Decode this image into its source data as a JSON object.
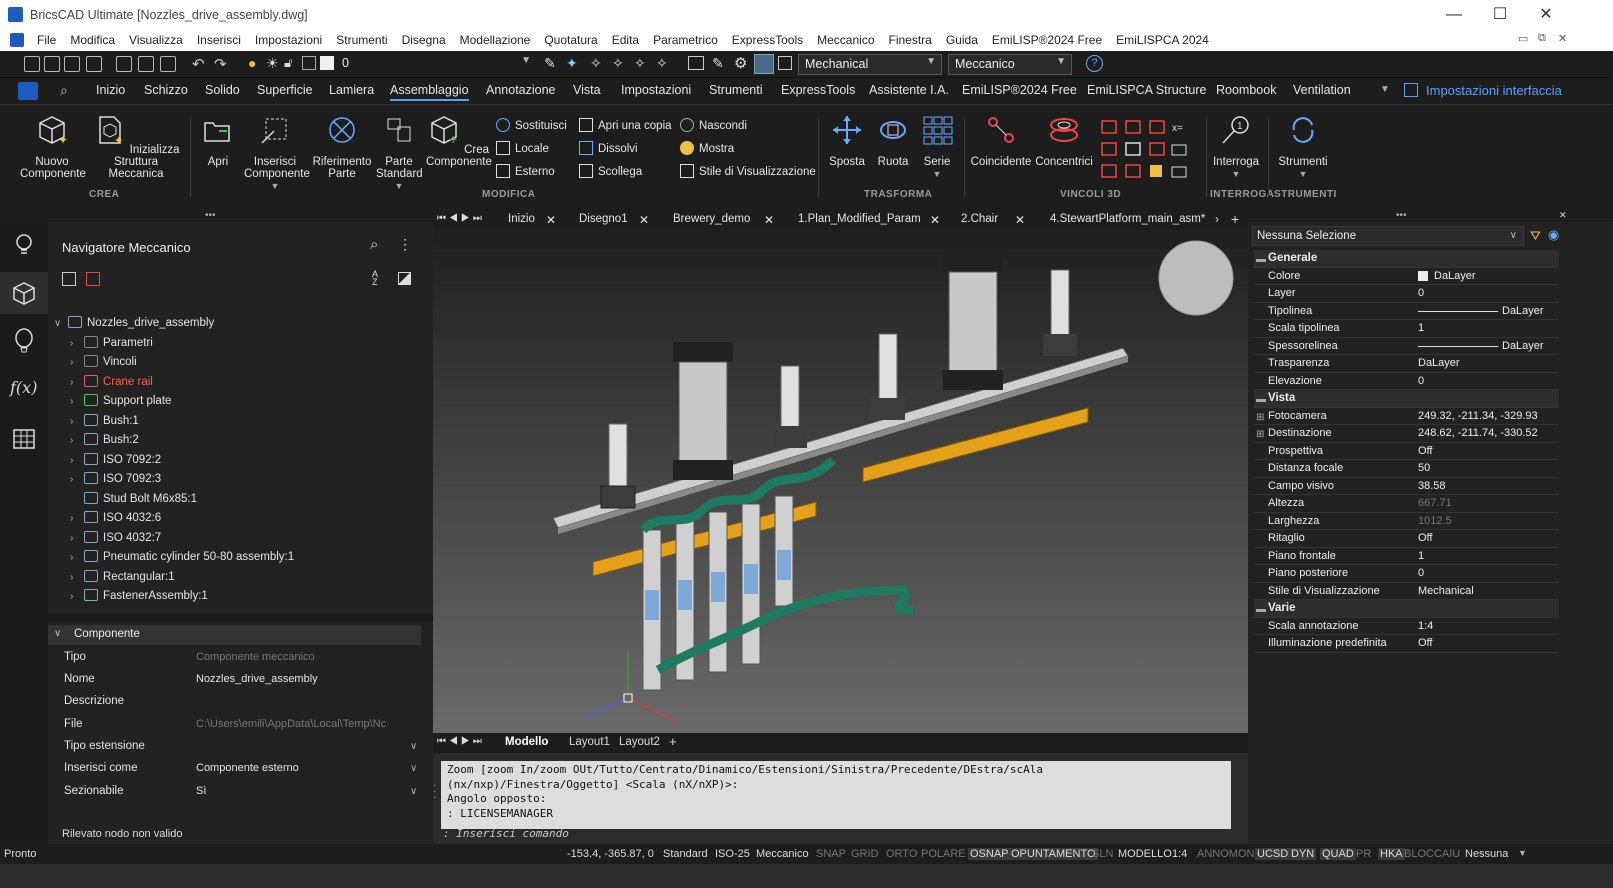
{
  "title_bar": {
    "app": "BricsCAD Ultimate",
    "file": "[Nozzles_drive_assembly.dwg]",
    "minimize": "—",
    "maximize": "☐",
    "close": "✕"
  },
  "menu": [
    "File",
    "Modifica",
    "Visualizza",
    "Inserisci",
    "Impostazioni",
    "Strumenti",
    "Disegna",
    "Modellazione",
    "Quotatura",
    "Edita",
    "Parametrico",
    "ExpressTools",
    "Meccanico",
    "Finestra",
    "Guida",
    "EmiLISP®2024 Free",
    "EmiLISPCA 2024"
  ],
  "qat": {
    "layer_value": "0",
    "workspace": "Mechanical",
    "profile": "Meccanico"
  },
  "ribbon_tabs": [
    "Inizio",
    "Schizzo",
    "Solido",
    "Superficie",
    "Lamiera",
    "Assemblaggio",
    "Annotazione",
    "Vista",
    "Impostazioni",
    "Strumenti",
    "ExpressTools",
    "Assistente I.A.",
    "EmiLISP®2024 Free",
    "EmiLISPCA Structure",
    "Roombook",
    "Ventilation"
  ],
  "ribbon_settings": "Impostazioni interfaccia",
  "ribbon": {
    "crea": {
      "label": "CREA",
      "nuovo": "Nuovo Componente",
      "inizializza": "Inizializza Struttura Meccanica"
    },
    "modifica": {
      "label": "MODIFICA",
      "apri": "Apri",
      "inserisci": "Inserisci Componente",
      "riferimento": "Riferimento Parte",
      "parte": "Parte Standard",
      "crea_comp": "Crea Componente",
      "sostituisci": "Sostituisci",
      "locale": "Locale",
      "esterno": "Esterno",
      "apri_copia": "Apri una copia",
      "dissolvi": "Dissolvi",
      "scollega": "Scollega",
      "nascondi": "Nascondi",
      "mostra": "Mostra",
      "stile": "Stile di Visualizzazione"
    },
    "trasforma": {
      "label": "TRASFORMA",
      "sposta": "Sposta",
      "ruota": "Ruota",
      "serie": "Serie"
    },
    "vincoli": {
      "label": "VINCOLI 3D",
      "coincidente": "Coincidente",
      "concentrici": "Concentrici"
    },
    "interroga": {
      "label": "INTERROGA",
      "interroga": "Interroga"
    },
    "strumenti": {
      "label": "STRUMENTI",
      "strumenti": "Strumenti"
    }
  },
  "navigator": {
    "title": "Navigatore Meccanico",
    "root": "Nozzles_drive_assembly",
    "items": [
      {
        "label": "Parametri",
        "color": "#e6e6e6"
      },
      {
        "label": "Vincoli",
        "color": "#e6e6e6"
      },
      {
        "label": "Crane rail",
        "color": "#ff5a5a"
      },
      {
        "label": "Support plate",
        "color": "#e6e6e6"
      },
      {
        "label": "Bush:1",
        "color": "#e6e6e6"
      },
      {
        "label": "Bush:2",
        "color": "#e6e6e6"
      },
      {
        "label": "ISO 7092:2",
        "color": "#e6e6e6"
      },
      {
        "label": "ISO 7092:3",
        "color": "#e6e6e6"
      },
      {
        "label": "Stud Bolt M6x85:1",
        "color": "#e6e6e6"
      },
      {
        "label": "ISO 4032:6",
        "color": "#e6e6e6"
      },
      {
        "label": "ISO 4032:7",
        "color": "#e6e6e6"
      },
      {
        "label": "Pneumatic cylinder 50-80 assembly:1",
        "color": "#e6e6e6"
      },
      {
        "label": "Rectangular:1",
        "color": "#e6e6e6"
      },
      {
        "label": "FastenerAssembly:1",
        "color": "#e6e6e6"
      }
    ]
  },
  "component": {
    "title": "Componente",
    "rows": [
      {
        "k": "Tipo",
        "v": "Componente meccanico",
        "dim": true
      },
      {
        "k": "Nome",
        "v": "Nozzles_drive_assembly",
        "dim": false
      },
      {
        "k": "Descrizione",
        "v": "",
        "dim": false
      },
      {
        "k": "File",
        "v": "C:\\Users\\emili\\AppData\\Local\\Temp\\Nc",
        "dim": true
      },
      {
        "k": "Tipo estensione",
        "v": "",
        "dim": false
      },
      {
        "k": "Inserisci come",
        "v": "Componente esterno",
        "dim": false
      },
      {
        "k": "Sezionabile",
        "v": "Sì",
        "dim": false
      }
    ],
    "status": "Rilevato nodo non valido"
  },
  "doc_tabs": [
    "Inizio",
    "Disegno1",
    "Brewery_demo",
    "1.Plan_Modified_Param",
    "2.Chair",
    "4.StewartPlatform_main_asm*"
  ],
  "layout_tabs": [
    "Modello",
    "Layout1",
    "Layout2"
  ],
  "command": {
    "lines": [
      "Zoom [zoom In/zoom OUt/Tutto/Centrato/Dinamico/Estensioni/Sinistra/Precedente/DEstra/scAla",
      "(nx/nxp)/Finestra/Oggetto] <Scala (nX/nXP)>:",
      "Angolo opposto:",
      ": LICENSEMANAGER"
    ],
    "prompt": ": Inserisci comando"
  },
  "properties": {
    "selection": "Nessuna Selezione",
    "rows": [
      {
        "k": "Generale",
        "sec": true
      },
      {
        "k": "Colore",
        "v": "DaLayer"
      },
      {
        "k": "Layer",
        "v": "0"
      },
      {
        "k": "Tipolinea",
        "v": "DaLayer"
      },
      {
        "k": "Scala tipolinea",
        "v": "1"
      },
      {
        "k": "Spessorelinea",
        "v": "DaLayer"
      },
      {
        "k": "Trasparenza",
        "v": "DaLayer"
      },
      {
        "k": "Elevazione",
        "v": "0"
      },
      {
        "k": "Vista",
        "sec": true
      },
      {
        "k": "Fotocamera",
        "v": "249.32, -211.34, -329.93"
      },
      {
        "k": "Destinazione",
        "v": "248.62, -211.74, -330.52"
      },
      {
        "k": "Prospettiva",
        "v": "Off"
      },
      {
        "k": "Distanza focale",
        "v": "50"
      },
      {
        "k": "Campo visivo",
        "v": "38.58"
      },
      {
        "k": "Altezza",
        "v": "667.71",
        "dim": true
      },
      {
        "k": "Larghezza",
        "v": "1012.5",
        "dim": true
      },
      {
        "k": "Ritaglio",
        "v": "Off"
      },
      {
        "k": "Piano frontale",
        "v": "1"
      },
      {
        "k": "Piano posteriore",
        "v": "0"
      },
      {
        "k": "Stile di Visualizzazione",
        "v": "Mechanical"
      },
      {
        "k": "Varie",
        "sec": true
      },
      {
        "k": "Scala annotazione",
        "v": "1:4"
      },
      {
        "k": "Illuminazione predefinita",
        "v": "Off"
      }
    ]
  },
  "statusbar": {
    "left": "Pronto",
    "coords": "-153.4, -365.87, 0",
    "items": [
      {
        "t": "Standard",
        "st": "n"
      },
      {
        "t": "ISO-25",
        "st": "n"
      },
      {
        "t": "Meccanico",
        "st": "n"
      },
      {
        "t": "SNAP",
        "st": "off"
      },
      {
        "t": "GRID",
        "st": "off"
      },
      {
        "t": "ORTO",
        "st": "off"
      },
      {
        "t": "POLARE",
        "st": "off"
      },
      {
        "t": "OSNAP",
        "st": "on"
      },
      {
        "t": "OPUNTAMENTO",
        "st": "on"
      },
      {
        "t": "SLN",
        "st": "off"
      },
      {
        "t": "MODELLO",
        "st": "n"
      },
      {
        "t": "1:4",
        "st": "n"
      },
      {
        "t": "ANNOMON",
        "st": "off"
      },
      {
        "t": "UCSD",
        "st": "on"
      },
      {
        "t": "DYN",
        "st": "on"
      },
      {
        "t": "QUAD",
        "st": "on"
      },
      {
        "t": "PR",
        "st": "off"
      },
      {
        "t": "HKA",
        "st": "on"
      },
      {
        "t": "BLOCCAIU",
        "st": "off"
      },
      {
        "t": "Nessuna",
        "st": "n"
      }
    ]
  }
}
